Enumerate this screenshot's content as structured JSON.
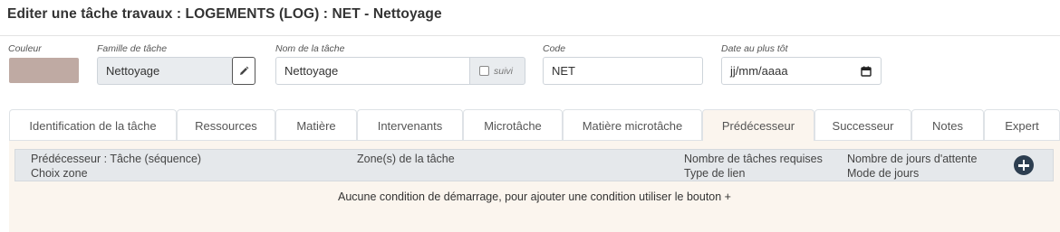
{
  "header": {
    "title": "Editer une tâche travaux : LOGEMENTS (LOG) : NET - Nettoyage"
  },
  "form": {
    "couleur": {
      "label": "Couleur",
      "color": "#bfaaa3"
    },
    "famille": {
      "label": "Famille de tâche",
      "value": "Nettoyage",
      "edit_icon": "pencil-icon"
    },
    "nom": {
      "label": "Nom de la tâche",
      "value": "Nettoyage",
      "suivi_label": "suivi",
      "suivi_checked": false
    },
    "code": {
      "label": "Code",
      "value": "NET"
    },
    "date": {
      "label": "Date au plus tôt",
      "placeholder": "jj/mm/aaaa",
      "icon": "calendar-icon"
    }
  },
  "tabs": [
    {
      "label": "Identification de la tâche"
    },
    {
      "label": "Ressources"
    },
    {
      "label": "Matière"
    },
    {
      "label": "Intervenants"
    },
    {
      "label": "Microtâche"
    },
    {
      "label": "Matière microtâche"
    },
    {
      "label": "Prédécesseur",
      "active": true
    },
    {
      "label": "Successeur"
    },
    {
      "label": "Notes"
    },
    {
      "label": "Expert"
    }
  ],
  "grid": {
    "col1_line1": "Prédécesseur : Tâche (séquence)",
    "col1_line2": "Choix zone",
    "col2_line1": "Zone(s) de la tâche",
    "col3_line1": "Nombre de tâches requises",
    "col3_line2": "Type de lien",
    "col4_line1": "Nombre de jours d'attente",
    "col4_line2": "Mode de jours",
    "add_icon": "plus-circle-icon",
    "empty_message": "Aucune condition de démarrage, pour ajouter une condition utiliser le bouton +"
  },
  "colors": {
    "active_tab_bg": "#fbf5ee",
    "grid_header_bg": "#e5e8eb",
    "add_button": "#2d3e50"
  }
}
